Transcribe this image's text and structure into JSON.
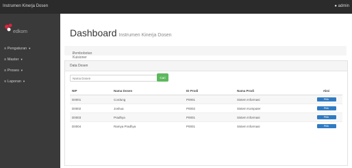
{
  "app": {
    "title": "Instrumen Kinerja Dosen",
    "user": "admin",
    "logo_text": "edkom"
  },
  "nav": [
    {
      "label": "Pengaturan"
    },
    {
      "label": "Master"
    },
    {
      "label": "Proses"
    },
    {
      "label": "Laporan"
    }
  ],
  "page": {
    "title": "Dashboard",
    "subtitle": "Instrumen Kinerja Dosen",
    "breadcrumb": "Pembobotan Kuisioner"
  },
  "panel": {
    "heading": "Data Dosen"
  },
  "search": {
    "placeholder": "Nama Dosen",
    "button": "Cari"
  },
  "table": {
    "headers": [
      "NIP",
      "Nama Dosen",
      "ID Prodi",
      "Nama Prodi",
      "Aksi"
    ],
    "rows": [
      {
        "nip": "D0001",
        "nama": "Cordung",
        "id_prodi": "P0001",
        "nama_prodi": "Sistem Informasi",
        "aksi": "Pilih"
      },
      {
        "nip": "D0002",
        "nama": "Joshua",
        "id_prodi": "P0002",
        "nama_prodi": "Sistem Komputer",
        "aksi": "Pilih"
      },
      {
        "nip": "D0003",
        "nama": "Pradhya",
        "id_prodi": "P0001",
        "nama_prodi": "Sistem Informasi",
        "aksi": "Pilih"
      },
      {
        "nip": "D0004",
        "nama": "Ramya Pradhya",
        "id_prodi": "P0001",
        "nama_prodi": "Sistem Informasi",
        "aksi": "Pilih"
      }
    ]
  },
  "colors": {
    "accent": "#2f7bc3",
    "success": "#5cb85c",
    "brand": "#d7263d"
  }
}
